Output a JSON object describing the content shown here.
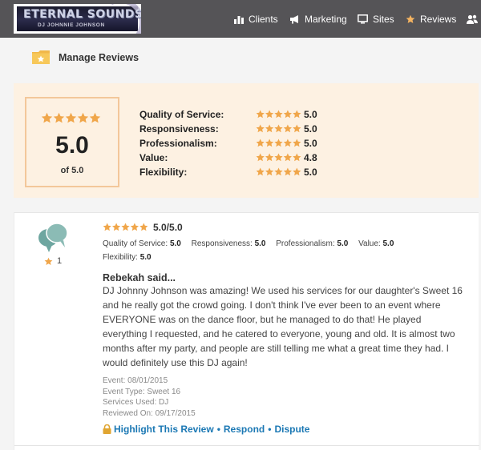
{
  "header": {
    "logo": {
      "title": "ETERNAL SOUNDS",
      "subtitle": "DJ JOHNNIE JOHNSON"
    },
    "nav": [
      {
        "label": "Clients",
        "icon": "bar-chart-icon"
      },
      {
        "label": "Marketing",
        "icon": "megaphone-icon"
      },
      {
        "label": "Sites",
        "icon": "monitor-icon"
      },
      {
        "label": "Reviews",
        "icon": "star-icon",
        "active": true
      },
      {
        "label": "",
        "icon": "users-icon"
      }
    ]
  },
  "page": {
    "title": "Manage Reviews",
    "icon": "folder-star-icon"
  },
  "summary": {
    "overall_score": "5.0",
    "overall_of": "of 5.0",
    "categories": [
      {
        "label": "Quality of Service:",
        "value": "5.0"
      },
      {
        "label": "Responsiveness:",
        "value": "5.0"
      },
      {
        "label": "Professionalism:",
        "value": "5.0"
      },
      {
        "label": "Value:",
        "value": "4.8"
      },
      {
        "label": "Flexibility:",
        "value": "5.0"
      }
    ]
  },
  "review": {
    "score": "5.0/5.0",
    "likes": "1",
    "categories": [
      {
        "label": "Quality of Service:",
        "value": "5.0"
      },
      {
        "label": "Responsiveness:",
        "value": "5.0"
      },
      {
        "label": "Professionalism:",
        "value": "5.0"
      },
      {
        "label": "Value:",
        "value": "5.0"
      },
      {
        "label": "Flexibility:",
        "value": "5.0"
      }
    ],
    "author": "Rebekah said...",
    "body": "DJ Johnny Johnson was amazing! We used his services for our daughter's Sweet 16 and he really got the crowd going. I don't think I've ever been to an event where EVERYONE was on the dance floor, but he managed to do that! He played everything I requested, and he catered to everyone, young and old. It is almost two months after my party, and people are still telling me what a great time they had. I would definitely use this DJ again!",
    "meta": {
      "event": "Event: 08/01/2015",
      "event_type": "Event Type: Sweet 16",
      "services": "Services Used: DJ",
      "reviewed_on": "Reviewed On: 09/17/2015"
    },
    "actions": {
      "highlight": "Highlight This Review",
      "respond": "Respond",
      "dispute": "Dispute",
      "separator": "•"
    }
  },
  "colors": {
    "topbar": "#555457",
    "star": "#f0a64a",
    "summary_bg": "#fdf1e2",
    "summary_border": "#f3c79a",
    "link": "#1b78b4",
    "bubble": "#6ea6a0"
  }
}
